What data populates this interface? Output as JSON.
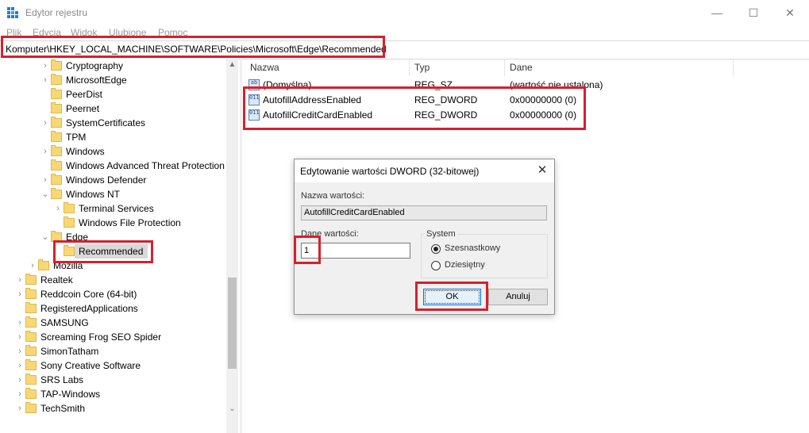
{
  "window": {
    "title": "Edytor rejestru",
    "minimize_glyph": "—",
    "maximize_glyph": "☐",
    "close_glyph": "✕"
  },
  "menu": [
    "Plik",
    "Edycja",
    "Widok",
    "Ulubione",
    "Pomoc"
  ],
  "address": "Komputer\\HKEY_LOCAL_MACHINE\\SOFTWARE\\Policies\\Microsoft\\Edge\\Recommended",
  "tree": [
    {
      "label": "Cryptography",
      "expand": "›"
    },
    {
      "label": "MicrosoftEdge",
      "expand": "›"
    },
    {
      "label": "PeerDist",
      "expand": ""
    },
    {
      "label": "Peernet",
      "expand": ""
    },
    {
      "label": "SystemCertificates",
      "expand": "›"
    },
    {
      "label": "TPM",
      "expand": ""
    },
    {
      "label": "Windows",
      "expand": "›"
    },
    {
      "label": "Windows Advanced Threat Protection",
      "expand": ""
    },
    {
      "label": "Windows Defender",
      "expand": "›"
    },
    {
      "label": "Windows NT",
      "expand": "⌄"
    },
    {
      "label": "Terminal Services",
      "expand": "›"
    },
    {
      "label": "Windows File Protection",
      "expand": ""
    },
    {
      "label": "Edge",
      "expand": "⌄"
    },
    {
      "label": "Recommended",
      "expand": ""
    },
    {
      "label": "Mozilla",
      "expand": "›"
    },
    {
      "label": "Realtek",
      "expand": "›"
    },
    {
      "label": "Reddcoin Core (64-bit)",
      "expand": "›"
    },
    {
      "label": "RegisteredApplications",
      "expand": ""
    },
    {
      "label": "SAMSUNG",
      "expand": "›"
    },
    {
      "label": "Screaming Frog SEO Spider",
      "expand": "›"
    },
    {
      "label": "SimonTatham",
      "expand": "›"
    },
    {
      "label": "Sony Creative Software",
      "expand": "›"
    },
    {
      "label": "SRS Labs",
      "expand": "›"
    },
    {
      "label": "TAP-Windows",
      "expand": "›"
    },
    {
      "label": "TechSmith",
      "expand": "›"
    }
  ],
  "scroll_up_glyph": "▲",
  "scroll_down_glyph": "⌄",
  "columns": {
    "name": "Nazwa",
    "type": "Typ",
    "data": "Dane"
  },
  "values": [
    {
      "name": "(Domyślna)",
      "type": "REG_SZ",
      "data": "(wartość nie ustalona)",
      "icon": "ab"
    },
    {
      "name": "AutofillAddressEnabled",
      "type": "REG_DWORD",
      "data": "0x00000000 (0)",
      "icon": "011"
    },
    {
      "name": "AutofillCreditCardEnabled",
      "type": "REG_DWORD",
      "data": "0x00000000 (0)",
      "icon": "011"
    }
  ],
  "dialog": {
    "title": "Edytowanie wartości DWORD (32-bitowej)",
    "close_glyph": "✕",
    "name_label": "Nazwa wartości:",
    "name_value": "AutofillCreditCardEnabled",
    "data_label": "Dane wartości:",
    "data_value": "1",
    "system_label": "System",
    "radio_hex": "Szesnastkowy",
    "radio_dec": "Dziesiętny",
    "selected_base": "hex",
    "ok": "OK",
    "cancel": "Anuluj"
  },
  "colors": {
    "highlight": "#d6202d",
    "folder": "#f8d775"
  }
}
